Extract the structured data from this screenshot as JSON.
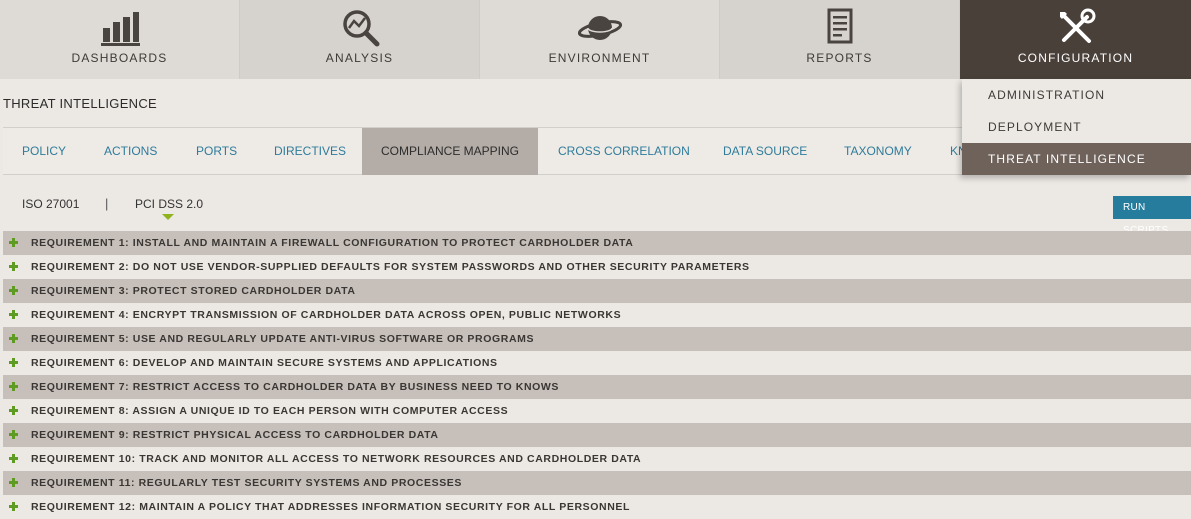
{
  "nav": {
    "tabs": [
      {
        "label": "DASHBOARDS",
        "icon": "dashboard-icon"
      },
      {
        "label": "ANALYSIS",
        "icon": "analysis-icon"
      },
      {
        "label": "ENVIRONMENT",
        "icon": "planet-icon"
      },
      {
        "label": "REPORTS",
        "icon": "report-icon"
      },
      {
        "label": "CONFIGURATION",
        "icon": "tools-icon",
        "active": true
      }
    ]
  },
  "config_menu": {
    "items": [
      {
        "label": "ADMINISTRATION"
      },
      {
        "label": "DEPLOYMENT"
      },
      {
        "label": "THREAT INTELLIGENCE",
        "active": true
      }
    ]
  },
  "page": {
    "title": "THREAT INTELLIGENCE"
  },
  "subtabs": [
    {
      "label": "POLICY"
    },
    {
      "label": "ACTIONS"
    },
    {
      "label": "PORTS"
    },
    {
      "label": "DIRECTIVES"
    },
    {
      "label": "COMPLIANCE MAPPING",
      "active": true
    },
    {
      "label": "CROSS CORRELATION"
    },
    {
      "label": "DATA SOURCE"
    },
    {
      "label": "TAXONOMY"
    },
    {
      "label": "KN"
    }
  ],
  "standards": {
    "items": [
      "ISO 27001",
      "PCI DSS 2.0"
    ],
    "separator": "|",
    "selected": "PCI DSS 2.0"
  },
  "run_scripts_label": "RUN SCRIPTS",
  "requirements": [
    "REQUIREMENT 1: INSTALL AND MAINTAIN A FIREWALL CONFIGURATION TO PROTECT CARDHOLDER DATA",
    "REQUIREMENT 2: DO NOT USE VENDOR-SUPPLIED DEFAULTS FOR SYSTEM PASSWORDS AND OTHER SECURITY PARAMETERS",
    "REQUIREMENT 3: PROTECT STORED CARDHOLDER DATA",
    "REQUIREMENT 4: ENCRYPT TRANSMISSION OF CARDHOLDER DATA ACROSS OPEN, PUBLIC NETWORKS",
    "REQUIREMENT 5: USE AND REGULARLY UPDATE ANTI-VIRUS SOFTWARE OR PROGRAMS",
    "REQUIREMENT 6: DEVELOP AND MAINTAIN SECURE SYSTEMS AND APPLICATIONS",
    "REQUIREMENT 7: RESTRICT ACCESS TO CARDHOLDER DATA BY BUSINESS NEED TO KNOWS",
    "REQUIREMENT 8: ASSIGN A UNIQUE ID TO EACH PERSON WITH COMPUTER ACCESS",
    "REQUIREMENT 9: RESTRICT PHYSICAL ACCESS TO CARDHOLDER DATA",
    "REQUIREMENT 10: TRACK AND MONITOR ALL ACCESS TO NETWORK RESOURCES AND CARDHOLDER DATA",
    "REQUIREMENT 11: REGULARLY TEST SECURITY SYSTEMS AND PROCESSES",
    "REQUIREMENT 12: MAINTAIN A POLICY THAT ADDRESSES INFORMATION SECURITY FOR ALL PERSONNEL"
  ]
}
